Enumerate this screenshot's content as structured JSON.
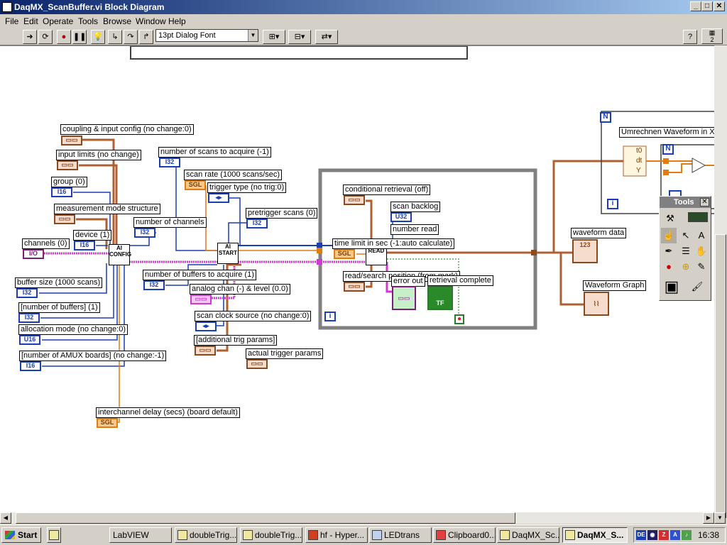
{
  "window": {
    "title": "DaqMX_ScanBuffer.vi Block Diagram",
    "minimize": "_",
    "maximize": "□",
    "close": "✕"
  },
  "menu": [
    "File",
    "Edit",
    "Operate",
    "Tools",
    "Browse",
    "Window",
    "Help"
  ],
  "toolbar": {
    "font": "13pt Dialog Font",
    "help": "?",
    "page_number": "2"
  },
  "diagram": {
    "labels": {
      "coupling": "coupling & input config (no change:0)",
      "input_limits": "input limits (no change)",
      "group": "group (0)",
      "measurement_mode": "measurement mode structure",
      "channels": "channels (0)",
      "device": "device (1)",
      "number_of_channels": "number of channels",
      "buffer_size": "buffer size (1000 scans)",
      "number_of_buffers": "[number of buffers] (1)",
      "allocation_mode": "allocation mode (no change:0)",
      "amux_boards": "[number of AMUX boards] (no change:-1)",
      "scans_to_acquire": "number of scans to acquire (-1)",
      "scan_rate": "scan rate (1000 scans/sec)",
      "trigger_type": "trigger type (no trig:0)",
      "pretrigger_scans": "pretrigger scans (0)",
      "buffers_to_acquire": "number of buffers to acquire (1)",
      "analog_chan": "analog chan (-) & level (0.0)",
      "scan_clock_source": "scan clock source (no change:0)",
      "additional_trig": "[additional trig params]",
      "actual_trigger": "actual trigger params",
      "interchannel_delay": "interchannel delay (secs) (board default)",
      "conditional_retrieval": "conditional retrieval (off)",
      "scan_backlog": "scan backlog",
      "number_read": "number read",
      "time_limit": "time limit in sec (-1:auto calculate)",
      "read_search_position": "read/search position (from mark)",
      "error_out": "error out",
      "retrieval_complete": "retrieval complete",
      "waveform_data": "waveform data",
      "waveform_graph": "Waveform Graph",
      "umrechnen": "Umrechnen Waveform in XY"
    },
    "terminals": {
      "cluster": "▭▭",
      "i16": "I16",
      "i32": "I32",
      "u16": "U16",
      "u32": "U32",
      "sgl": "SGL",
      "io": "I/O",
      "enum": "◂▸",
      "tf": "TF",
      "array": "123"
    },
    "vi_nodes": {
      "ai_config": "AI CONFIG",
      "ai_start": "AI START",
      "ai_read": "READ"
    },
    "loop_markers": {
      "loop_i": "i",
      "for_n": "N",
      "waveform_t0": "t0",
      "waveform_dt": "dt",
      "waveform_y": "Y"
    }
  },
  "tools_palette": {
    "title": "Tools",
    "items": [
      "auto-tool",
      "operate-tool",
      "position-tool",
      "label-tool",
      "wiring-tool",
      "shortcut-menu-tool",
      "scroll-tool",
      "breakpoint-tool",
      "probe-tool",
      "color-copy-tool",
      "coloring-tool"
    ]
  },
  "taskbar": {
    "start": "Start",
    "tasks": [
      "LabVIEW",
      "doubleTrig...",
      "doubleTrig...",
      "hf - Hyper...",
      "LEDtrans",
      "Clipboard0...",
      "DaqMX_Sc...",
      "DaqMX_S..."
    ],
    "tray": {
      "lang": "DE",
      "clock": "16:38"
    }
  },
  "colors": {
    "title_start": "#0a246a",
    "title_end": "#a6caf0",
    "wire_orange": "#e07d10",
    "wire_blue": "#1a3fb4",
    "wire_pink": "#d03ad0",
    "wire_brown": "#b06030",
    "loop_gray": "#808080"
  }
}
